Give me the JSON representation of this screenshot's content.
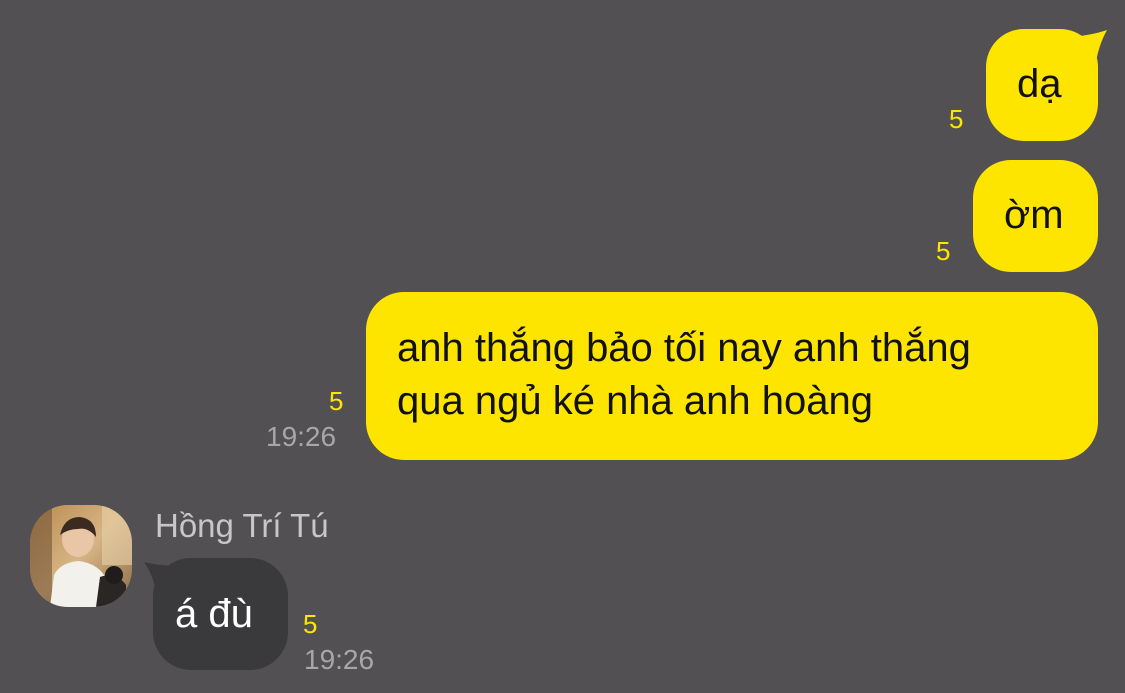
{
  "colors": {
    "background": "#525052",
    "outgoing_bubble": "#fee500",
    "incoming_bubble": "#3a393b",
    "unread_count": "#fee500",
    "timestamp": "#a7a6a8"
  },
  "messages": [
    {
      "direction": "outgoing",
      "text": "dạ",
      "unread": "5",
      "time": ""
    },
    {
      "direction": "outgoing",
      "text": "ờm",
      "unread": "5",
      "time": ""
    },
    {
      "direction": "outgoing",
      "text_lines": [
        "anh thắng bảo tối nay anh thắng",
        "qua ngủ ké nhà anh hoàng"
      ],
      "unread": "5",
      "time": "19:26"
    },
    {
      "direction": "incoming",
      "sender": "Hồng Trí Tú",
      "avatar_icon": "profile-photo-avatar",
      "text": "á đù",
      "unread": "5",
      "time": "19:26"
    }
  ]
}
